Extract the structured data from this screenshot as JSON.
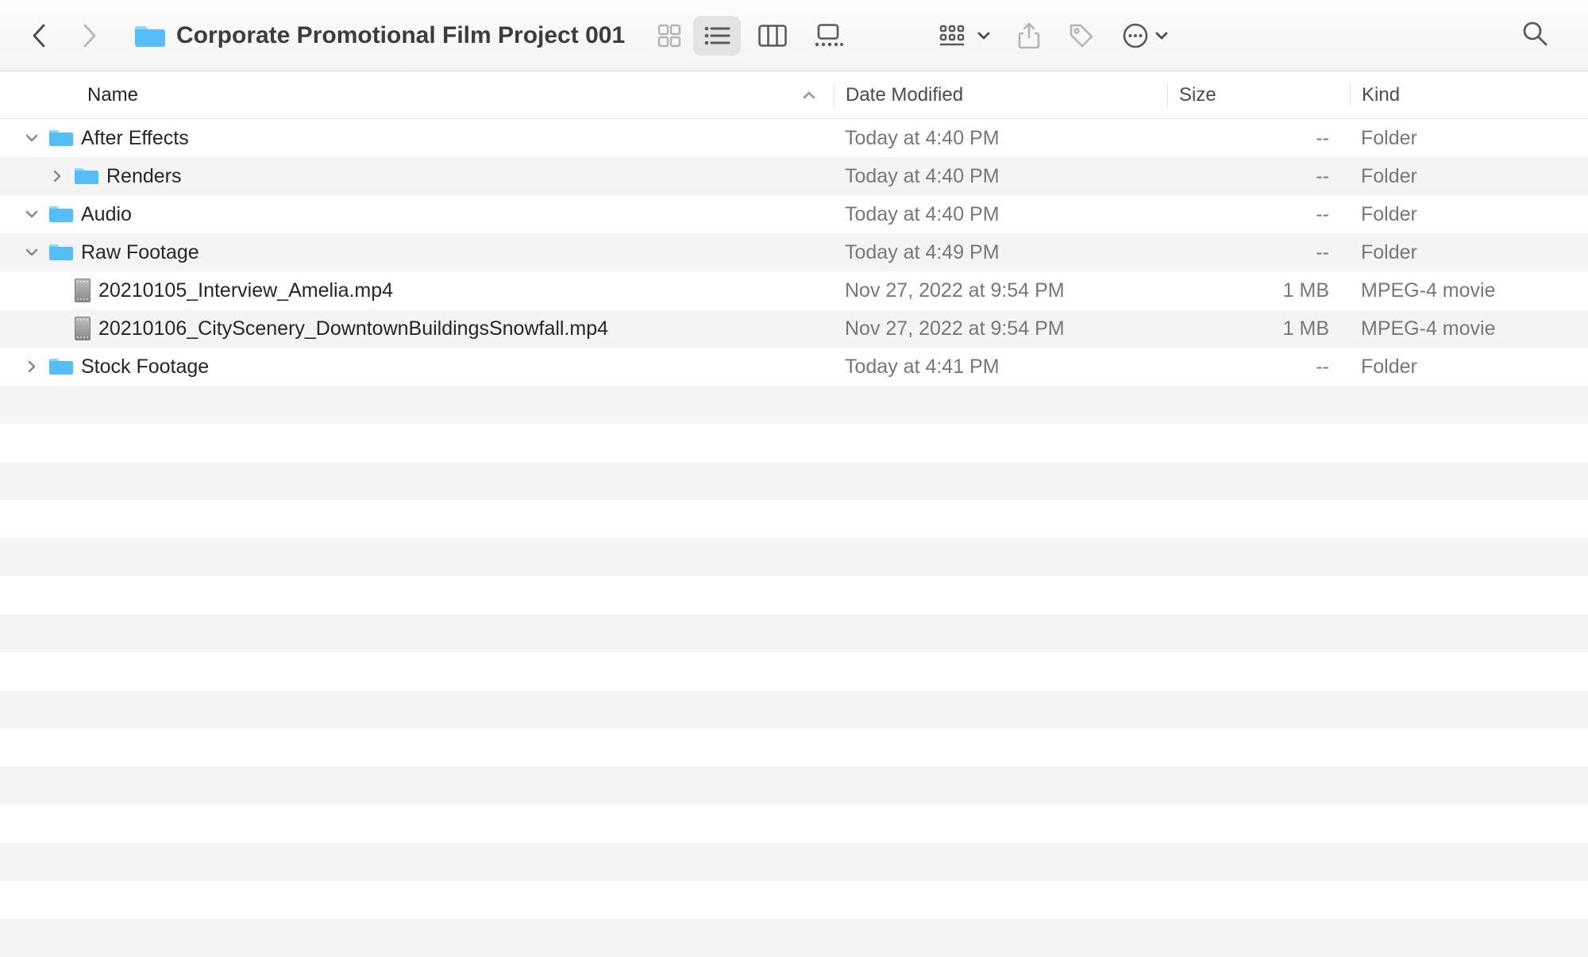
{
  "toolbar": {
    "folder_name": "Corporate Promotional Film Project 001"
  },
  "columns": {
    "name": "Name",
    "date": "Date Modified",
    "size": "Size",
    "kind": "Kind"
  },
  "rows": [
    {
      "indent": 0,
      "disclosure": "down",
      "icon": "folder",
      "name": "After Effects",
      "date": "Today at 4:40 PM",
      "size": "--",
      "kind": "Folder"
    },
    {
      "indent": 1,
      "disclosure": "right",
      "icon": "folder",
      "name": "Renders",
      "date": "Today at 4:40 PM",
      "size": "--",
      "kind": "Folder"
    },
    {
      "indent": 0,
      "disclosure": "down",
      "icon": "folder",
      "name": "Audio",
      "date": "Today at 4:40 PM",
      "size": "--",
      "kind": "Folder"
    },
    {
      "indent": 0,
      "disclosure": "down",
      "icon": "folder",
      "name": "Raw Footage",
      "date": "Today at 4:49 PM",
      "size": "--",
      "kind": "Folder"
    },
    {
      "indent": 1,
      "disclosure": "none",
      "icon": "movie",
      "name": "20210105_Interview_Amelia.mp4",
      "date": "Nov 27, 2022 at 9:54 PM",
      "size": "1 MB",
      "kind": "MPEG-4 movie"
    },
    {
      "indent": 1,
      "disclosure": "none",
      "icon": "movie",
      "name": "20210106_CityScenery_DowntownBuildingsSnowfall.mp4",
      "date": "Nov 27, 2022 at 9:54 PM",
      "size": "1 MB",
      "kind": "MPEG-4 movie"
    },
    {
      "indent": 0,
      "disclosure": "right",
      "icon": "folder",
      "name": "Stock Footage",
      "date": "Today at 4:41 PM",
      "size": "--",
      "kind": "Folder"
    }
  ],
  "empty_row_count": 15
}
